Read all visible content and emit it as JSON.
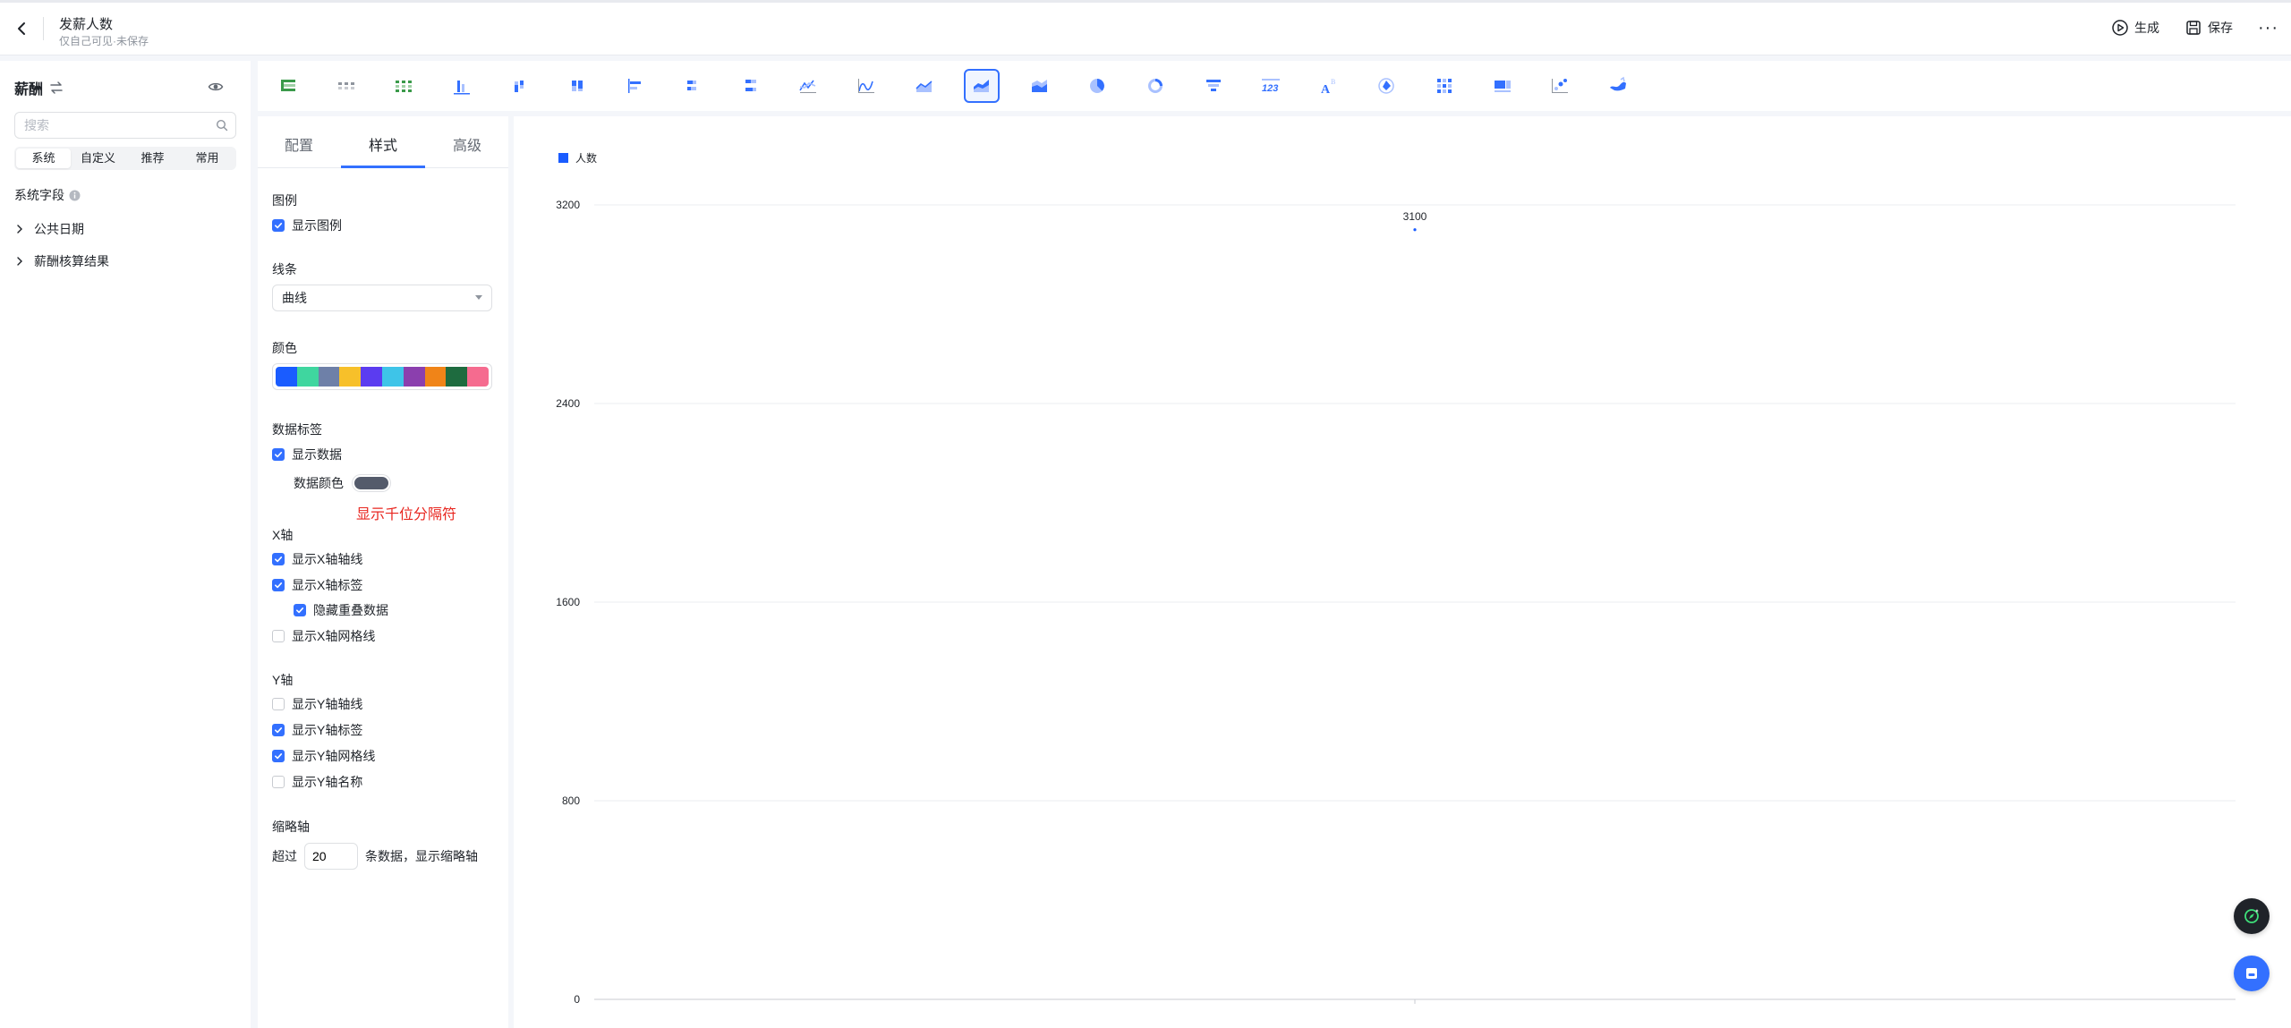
{
  "header": {
    "title": "发薪人数",
    "subtitle": "仅自己可见·未保存",
    "generate_label": "生成",
    "save_label": "保存"
  },
  "left_panel": {
    "title": "薪酬",
    "search_placeholder": "搜索",
    "tabs": [
      "系统",
      "自定义",
      "推荐",
      "常用"
    ],
    "active_tab": 0,
    "section_label": "系统字段",
    "tree_items": [
      "公共日期",
      "薪酬核算结果"
    ]
  },
  "chart_types": {
    "icons": [
      "table-icon",
      "detail-table-icon",
      "pivot-table-icon",
      "column-chart-icon",
      "stacked-column-icon",
      "percent-column-icon",
      "bar-chart-icon",
      "stacked-bar-icon",
      "percent-bar-icon",
      "line-chart-icon",
      "smooth-line-icon",
      "area-chart-icon",
      "stacked-area-icon",
      "percent-area-icon",
      "pie-chart-icon",
      "donut-chart-icon",
      "funnel-chart-icon",
      "indicator-card-icon",
      "word-cloud-icon",
      "radar-chart-icon",
      "heatmap-icon",
      "combo-chart-icon",
      "scatter-chart-icon",
      "map-chart-icon"
    ],
    "active_index": 12
  },
  "config": {
    "tabs": [
      "配置",
      "样式",
      "高级"
    ],
    "active_tab": 1,
    "legend_section": "图例",
    "show_legend": {
      "label": "显示图例",
      "checked": true
    },
    "line_section": "线条",
    "line_value": "曲线",
    "color_section": "颜色",
    "palette": [
      "#1a5cff",
      "#3fd69f",
      "#6e80a8",
      "#f7c02a",
      "#5b3cf0",
      "#3ec4e8",
      "#8b3fae",
      "#f08418",
      "#1e6b3f",
      "#f56b8f"
    ],
    "data_label_section": "数据标签",
    "show_data": {
      "label": "显示数据",
      "checked": true
    },
    "data_color_label": "数据颜色",
    "data_color": "#545b6b",
    "thousand_sep_note": "显示千位分隔符",
    "thousand_sep_color": "#e8261f",
    "x_section": "X轴",
    "x_options": [
      {
        "label": "显示X轴轴线",
        "checked": true
      },
      {
        "label": "显示X轴标签",
        "checked": true
      },
      {
        "label": "隐藏重叠数据",
        "checked": true
      },
      {
        "label": "显示X轴网格线",
        "checked": false
      }
    ],
    "y_section": "Y轴",
    "y_options": [
      {
        "label": "显示Y轴轴线",
        "checked": false
      },
      {
        "label": "显示Y轴标签",
        "checked": true
      },
      {
        "label": "显示Y轴网格线",
        "checked": true
      },
      {
        "label": "显示Y轴名称",
        "checked": false
      }
    ],
    "thumb_section": "缩略轴",
    "thumb_prefix": "超过",
    "thumb_value": "20",
    "thumb_suffix": "条数据，显示缩略轴"
  },
  "chart_data": {
    "type": "area",
    "categories": [
      ""
    ],
    "series": [
      {
        "name": "人数",
        "values": [
          3100
        ],
        "color": "#1a5cff"
      }
    ],
    "data_labels": [
      "3100"
    ],
    "y_ticks": [
      0,
      800,
      1600,
      2400,
      3200
    ],
    "ylim": [
      0,
      3200
    ],
    "grid": true,
    "legend": "top-left"
  }
}
